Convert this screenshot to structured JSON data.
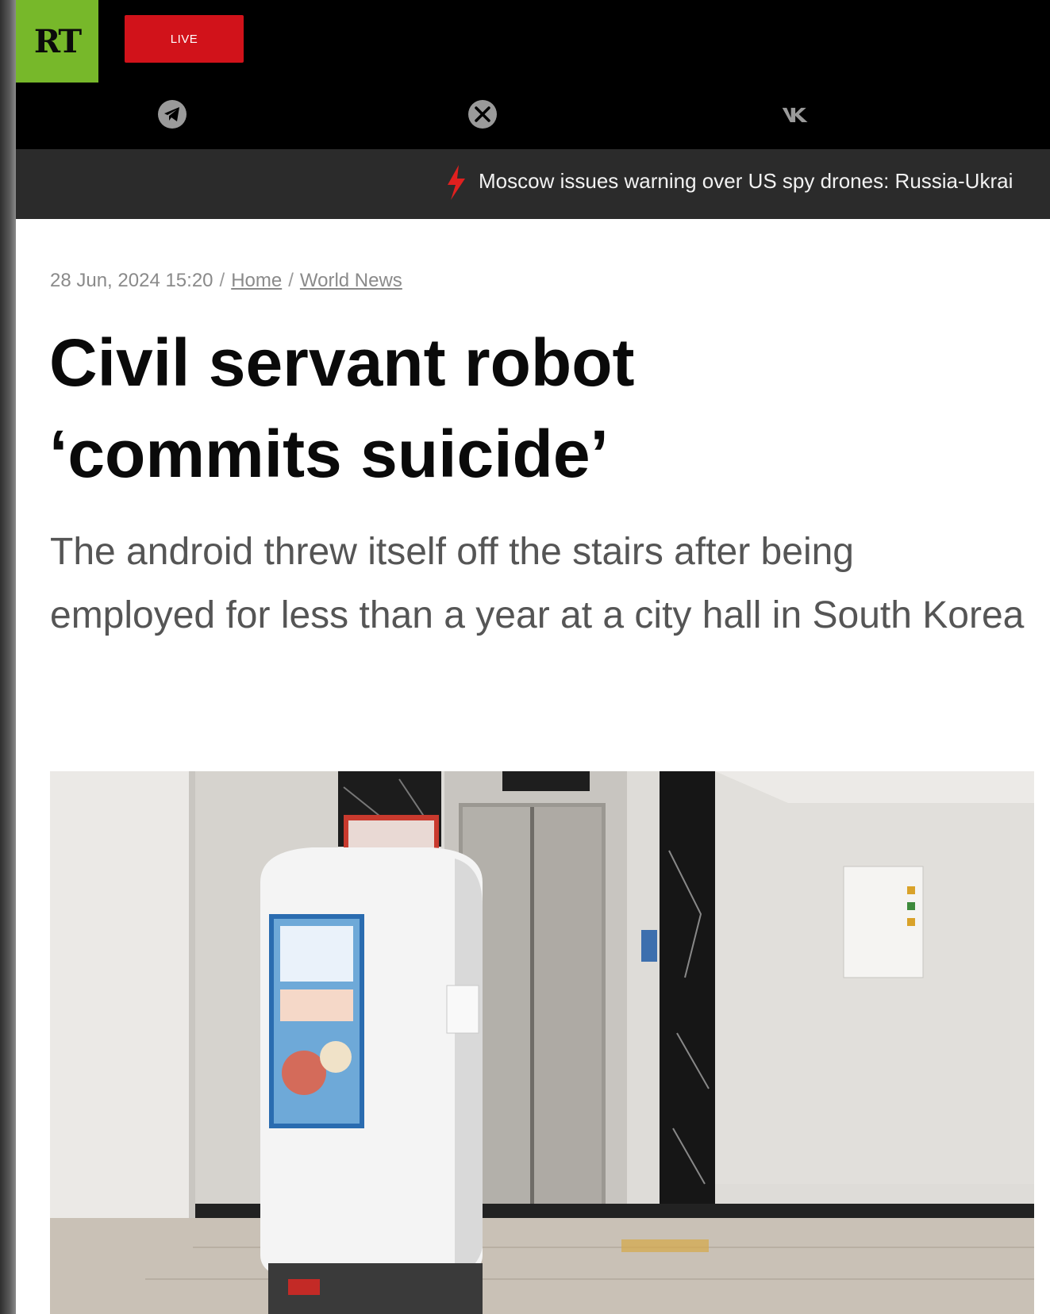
{
  "header": {
    "logo_text": "RT",
    "live_label": "LIVE",
    "social_icons": [
      "telegram-icon",
      "x-icon",
      "vk-icon"
    ]
  },
  "ticker": {
    "icon": "lightning-icon",
    "text": "Moscow issues warning over US spy drones: Russia-Ukrai"
  },
  "article": {
    "date": "28 Jun, 2024 15:20",
    "breadcrumb": [
      "Home",
      "World News"
    ],
    "headline_line1": "Civil servant robot",
    "headline_line2": "‘commits suicide’",
    "summary": "The android threw itself off the stairs after being employed for less than a year at a city hall in South Korea"
  },
  "colors": {
    "logo_green": "#77b82a",
    "live_red": "#d1121a",
    "ticker_bolt": "#e0201f",
    "topbar": "#000000",
    "ticker_bg": "#2b2b2b"
  }
}
